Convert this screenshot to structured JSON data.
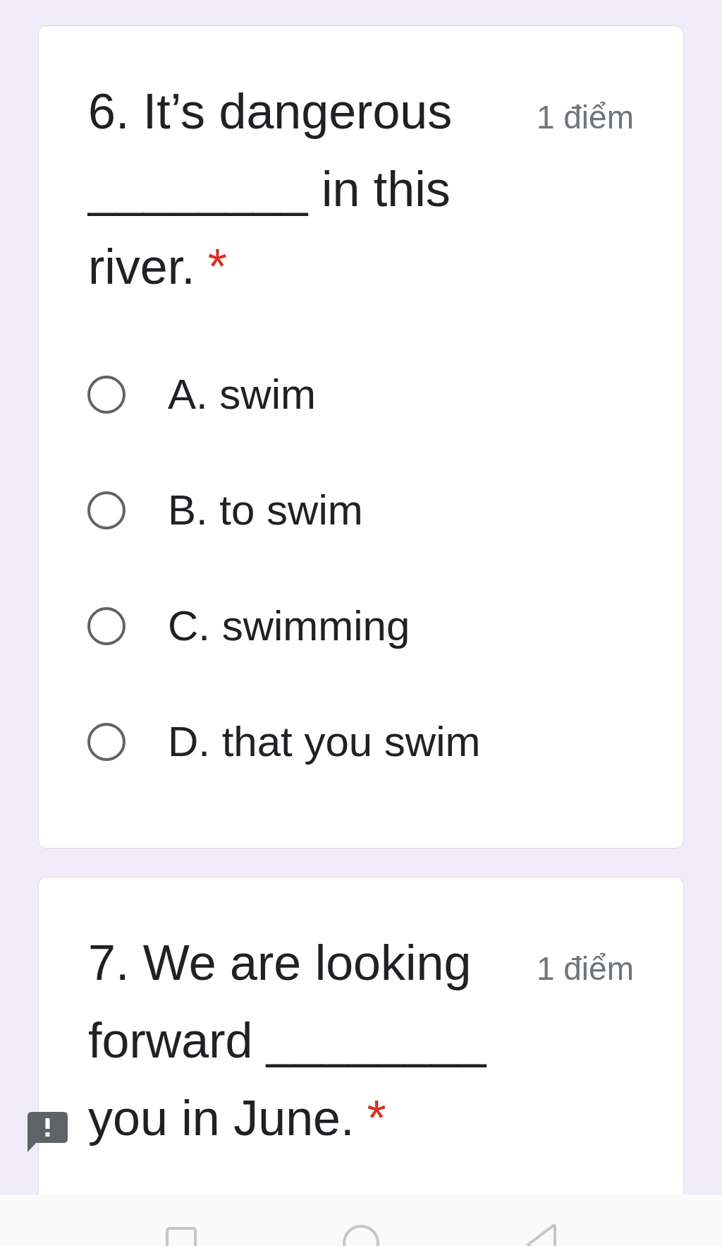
{
  "questions": [
    {
      "title": "6. It’s dangerous ________ in this river.",
      "required_mark": "*",
      "points": "1 điểm",
      "options": [
        {
          "label": "A. swim",
          "selected": false
        },
        {
          "label": "B. to swim",
          "selected": false
        },
        {
          "label": "C. swimming",
          "selected": false
        },
        {
          "label": "D. that you swim",
          "selected": false
        }
      ]
    },
    {
      "title": "7. We are looking forward ________ you in June.",
      "required_mark": "*",
      "points": "1 điểm"
    }
  ]
}
